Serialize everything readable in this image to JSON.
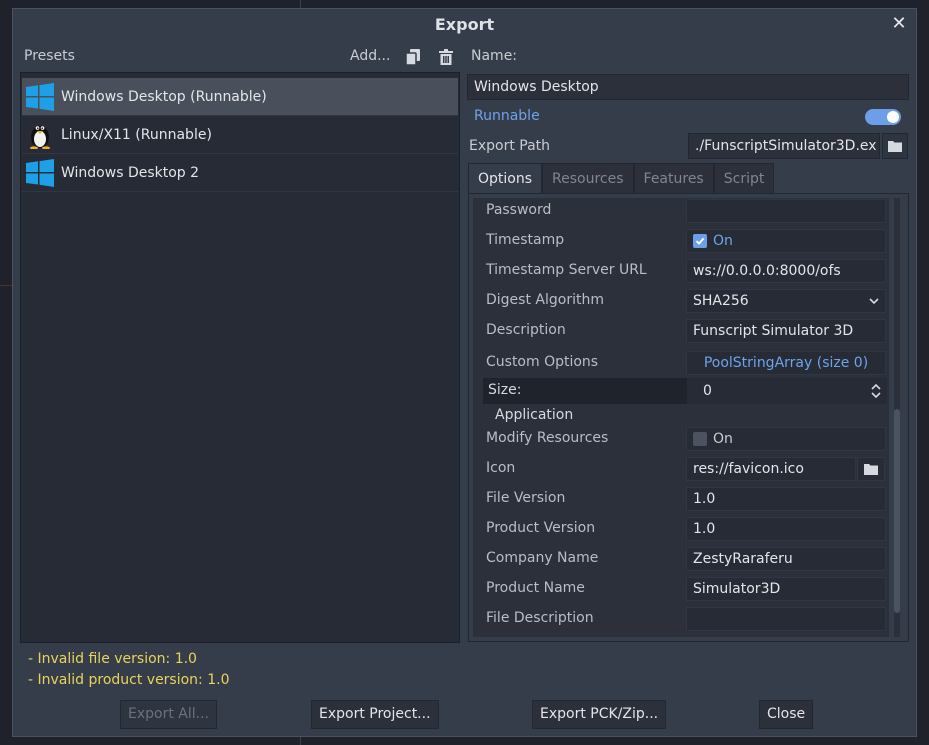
{
  "dialog": {
    "title": "Export",
    "close_icon": "close-icon"
  },
  "presets": {
    "label": "Presets",
    "add_label": "Add...",
    "items": [
      {
        "label": "Windows Desktop (Runnable)",
        "icon": "windows-icon",
        "selected": true
      },
      {
        "label": "Linux/X11 (Runnable)",
        "icon": "linux-penguin-icon",
        "selected": false
      },
      {
        "label": "Windows Desktop 2",
        "icon": "windows-icon",
        "selected": false
      }
    ]
  },
  "errors": [
    "- Invalid file version: 1.0",
    "- Invalid product version: 1.0"
  ],
  "preset_settings": {
    "name_label": "Name:",
    "name_value": "Windows Desktop",
    "runnable_label": "Runnable",
    "runnable_on": true,
    "export_path_label": "Export Path",
    "export_path_value": "./FunscriptSimulator3D.ex"
  },
  "tabs": [
    "Options",
    "Resources",
    "Features",
    "Script"
  ],
  "options": {
    "password": {
      "label": "Password",
      "value": ""
    },
    "timestamp": {
      "label": "Timestamp",
      "value": "On",
      "checked": true
    },
    "timestamp_server_url": {
      "label": "Timestamp Server URL",
      "value": "ws://0.0.0.0:8000/ofs"
    },
    "digest_algorithm": {
      "label": "Digest Algorithm",
      "value": "SHA256"
    },
    "description": {
      "label": "Description",
      "value": "Funscript Simulator 3D"
    },
    "custom_options": {
      "label": "Custom Options",
      "value": "PoolStringArray (size 0)"
    },
    "size": {
      "label": "Size:",
      "value": "0"
    },
    "application_section": "Application",
    "modify_resources": {
      "label": "Modify Resources",
      "value": "On",
      "checked": false
    },
    "icon": {
      "label": "Icon",
      "value": "res://favicon.ico"
    },
    "file_version": {
      "label": "File Version",
      "value": "1.0"
    },
    "product_version": {
      "label": "Product Version",
      "value": "1.0"
    },
    "company_name": {
      "label": "Company Name",
      "value": "ZestyRaraferu"
    },
    "product_name": {
      "label": "Product Name",
      "value": "Simulator3D"
    },
    "file_description": {
      "label": "File Description",
      "value": ""
    }
  },
  "footer": {
    "export_all": "Export All...",
    "export_project": "Export Project...",
    "export_pck_zip": "Export PCK/Zip...",
    "close": "Close"
  },
  "colors": {
    "accent": "#6d9fe8",
    "warning_text": "#e8d35a",
    "panel_bg": "#363d4a"
  }
}
